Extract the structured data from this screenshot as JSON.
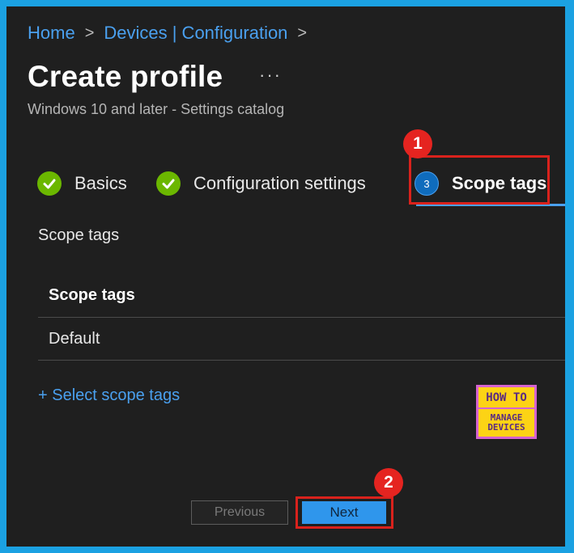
{
  "breadcrumb": {
    "items": [
      "Home",
      "Devices | Configuration"
    ],
    "separator": ">"
  },
  "header": {
    "title": "Create profile",
    "more": "···",
    "subtitle": "Windows 10 and later - Settings catalog"
  },
  "steps": [
    {
      "label": "Basics",
      "status": "complete",
      "icon": "check-icon"
    },
    {
      "label": "Configuration settings",
      "status": "complete",
      "icon": "check-icon"
    },
    {
      "label": "Scope tags",
      "status": "active",
      "number": "3"
    }
  ],
  "content": {
    "section_label": "Scope tags",
    "table": {
      "header": "Scope tags",
      "rows": [
        "Default"
      ]
    },
    "select_link": "+ Select scope tags"
  },
  "logo": {
    "line1": "HOW TO",
    "line2": "MANAGE",
    "line3": "DEVICES"
  },
  "footer": {
    "previous_label": "Previous",
    "next_label": "Next"
  },
  "annotations": {
    "badge1": "1",
    "badge2": "2"
  },
  "colors": {
    "accent": "#4aa0ef",
    "success": "#6bb700",
    "highlight": "#d9221c",
    "primary_button": "#2f96ec"
  }
}
